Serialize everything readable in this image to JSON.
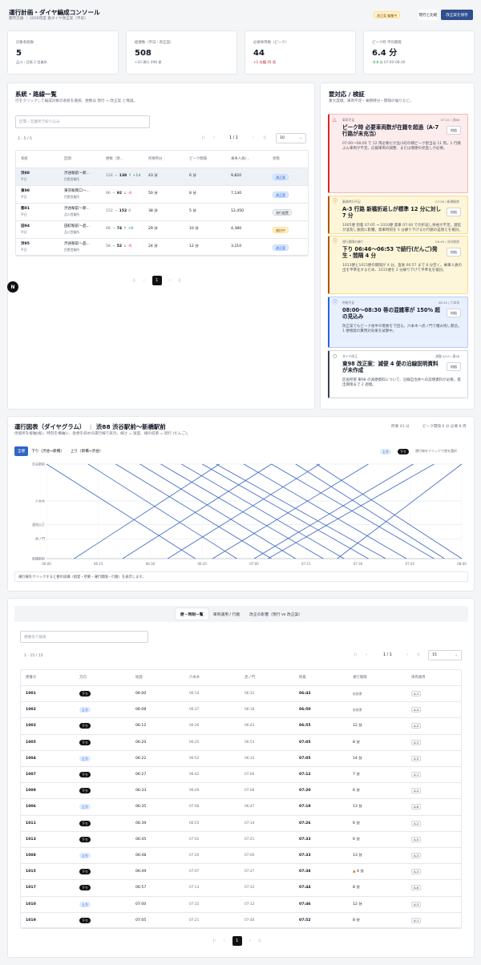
{
  "header": {
    "title": "運行計画・ダイヤ編成コンソール",
    "subtitle": "都市交通 ｜ 2026年度 春ダイヤ改正案（平日）",
    "status_badge": "改正案 編集中",
    "compare_label": "現行と比較",
    "save_label": "改正案を保存"
  },
  "kpis": [
    {
      "label": "対象系統数",
      "value": "5",
      "note": "品川・目黒 2 営業所"
    },
    {
      "label": "総便数（平日・改正案）",
      "value": "508",
      "note": "+10 現行 498 便"
    },
    {
      "label": "必要車両数（ピーク）",
      "value": "44",
      "note": "+1 在籍 45 両"
    },
    {
      "label": "ピーク時 平均間隔",
      "value": "6.4 分",
      "note_delta": "-0.8 分",
      "note": "07:00–08:30"
    }
  ],
  "routes": {
    "title": "系統・路線一覧",
    "description": "行をクリックして編成対象の系統を選択。便数は 現行 → 改正案 と増減。",
    "filter_placeholder": "区間・営業所で絞り込み",
    "count": "1 - 5 / 5",
    "page": "1 / 1",
    "page_size": "10",
    "columns": [
      "系統",
      "区間",
      "便数（現...",
      "所要時分",
      "ピーク間隔",
      "乗車人員/...",
      "状態"
    ],
    "rows": [
      {
        "code": "渋88",
        "day": "平日",
        "section": "渋谷駅前〜新...",
        "depot": "目黒営業所",
        "cur": "124",
        "new": "138",
        "delta": "↑ +14",
        "time": "43 分",
        "interval": "6 分",
        "riders": "9,820",
        "status": "改正案",
        "status_kind": "blue"
      },
      {
        "code": "東98",
        "day": "平日",
        "section": "東京駅南口〜...",
        "depot": "目黒営業所",
        "cur": "96",
        "new": "92",
        "delta": "↓ -4",
        "time": "50 分",
        "interval": "8 分",
        "riders": "7,140",
        "status": "改正案",
        "status_kind": "blue"
      },
      {
        "code": "都01",
        "day": "平日",
        "section": "渋谷駅前〜新...",
        "depot": "品川営業所",
        "cur": "152",
        "new": "152",
        "delta": "0",
        "time": "38 分",
        "interval": "5 分",
        "riders": "12,450",
        "status": "現行据置",
        "status_kind": "gray"
      },
      {
        "code": "田94",
        "day": "平日",
        "section": "田町駅前〜品...",
        "depot": "品川営業所",
        "cur": "68",
        "new": "74",
        "delta": "↑ +6",
        "time": "29 分",
        "interval": "10 分",
        "riders": "4,380",
        "status": "検討中",
        "status_kind": "yellow"
      },
      {
        "code": "渋95",
        "day": "平日",
        "section": "渋谷駅前〜品...",
        "depot": "目黒営業所",
        "cur": "58",
        "new": "52",
        "delta": "↓ -6",
        "time": "24 分",
        "interval": "12 分",
        "riders": "3,210",
        "status": "改正案",
        "status_kind": "blue"
      }
    ],
    "pager_page": "1"
  },
  "alerts": {
    "title": "要対応 / 検証",
    "description": "重大度順。車両不足・乗務時分・間隔の偏りなど。",
    "action_label": "対応",
    "items": [
      {
        "kind": "red",
        "category": "車両不足",
        "meta": "07:12 / 渋88",
        "title": "ピーク時 必要車両数が在籍を超過（A-7 行路が未充当）",
        "body": "07:00〜08:00 で 12 両必要だが品川町の朝ピーク割当は 11 両。1 行路ぶん車両が不足。応援車両の調整、または増便の見直しが必要。"
      },
      {
        "kind": "yellow",
        "category": "乗務時分不足",
        "meta": "07:06 / 新橋駅前",
        "title": "A-3 行路 新橋折返しが標準 12 分に対し 7 分",
        "body": "1005便 到着 07:05 → 1010便 発車 07:00 での折返し余裕が不足。遅延が波及し後続に影響。発車時刻を 5 分繰り下げるか行路の差替えを検討。"
      },
      {
        "kind": "yellow",
        "category": "運行間隔の偏り",
        "meta": "06:49 / 渋谷駅前",
        "title": "下り 06:46〜06:53 で続行(だんご)発生・間隔 4 分",
        "body": "1013便と1015便の間隔が 4 分。直後 06:57 まで 8 分空く。乗車人員の出を平準化するため、1015便を 2 分繰り下げて平準化を検討。"
      },
      {
        "kind": "blue",
        "category": "供給不足",
        "meta": "08:10 / 六本木",
        "title": "08:00〜08:30 帯の混雑率が 150% 超の見込み",
        "body": "改正案でもピーク後半の需要を下回る。六本木〜虎ノ門で積み残し懸念。1 便増発の費用対効果を試算中。"
      },
      {
        "kind": "white",
        "category": "ダイヤ改正",
        "meta": "調整 4/13 / 東98",
        "title": "東98 改正案：減便 4 便の沿線説明資料が未作成",
        "body": "区長所管 東98 の減便資料について、沿線自治体への説明資料が必要。提出期限まで 2 週間。"
      }
    ]
  },
  "diagram": {
    "title": "運行図表（ダイヤグラム）",
    "route": "渋88 渋谷駅前〜新橋駅前",
    "description": "停留所を縦軸(縦)、時刻を横軸に、各便を斜めの運行線で表示。線さ = 速度、線の収束 = 続行 (だんご)。",
    "meta": [
      "所要 43 分",
      "ピーク間隔 6 分",
      "必要 8 両"
    ],
    "tabs": [
      "全便",
      "下り（渋谷→新橋）",
      "上り（新橋→渋谷）"
    ],
    "legend_up": "上り",
    "legend_down": "下り",
    "legend_note": "運行線をクリックで便を選択",
    "stops": [
      "渋谷駅前",
      "六本木",
      "溜池山王",
      "虎ノ門",
      "新橋駅前"
    ],
    "times": [
      "06:00",
      "06:15",
      "06:30",
      "06:45",
      "07:00",
      "07:15",
      "07:30",
      "07:45",
      "08:00"
    ],
    "footer": "運行線をクリックすると便の詳細（始発・所要・運行間隔・行路）を表示します。"
  },
  "trips": {
    "tabs": [
      "便・時刻一覧",
      "車両運用 / 行路",
      "改正の影響（現行 vs 改正案）"
    ],
    "search_placeholder": "便番号で検索",
    "count": "1 - 15 / 15",
    "page": "1 / 1",
    "page_size": "15",
    "columns": [
      "便番号",
      "方向",
      "始発",
      "六本木",
      "虎ノ門",
      "終着",
      "運行間隔",
      "車両運用"
    ],
    "rows": [
      {
        "no": "1001",
        "dir": "下り",
        "start": "06:00",
        "roppongi": "06:14",
        "toranomon": "06:31",
        "end": "06:43",
        "interval": "始発便",
        "vehicle": "A-1"
      },
      {
        "no": "1002",
        "dir": "上り",
        "start": "06:08",
        "roppongi": "06:37",
        "toranomon": "06:18",
        "end": "06:50",
        "interval": "始発便",
        "vehicle": "A-4"
      },
      {
        "no": "1003",
        "dir": "下り",
        "start": "06:12",
        "roppongi": "06:26",
        "toranomon": "06:43",
        "end": "06:55",
        "interval": "12 分",
        "vehicle": "A-2"
      },
      {
        "no": "1005",
        "dir": "下り",
        "start": "06:20",
        "roppongi": "06:35",
        "toranomon": "06:53",
        "end": "07:05",
        "interval": "8 分",
        "vehicle": "A-3"
      },
      {
        "no": "1004",
        "dir": "上り",
        "start": "06:22",
        "roppongi": "06:52",
        "toranomon": "06:33",
        "end": "07:05",
        "interval": "14 分",
        "vehicle": "A-5"
      },
      {
        "no": "1007",
        "dir": "下り",
        "start": "06:27",
        "roppongi": "06:42",
        "toranomon": "07:00",
        "end": "07:12",
        "interval": "7 分",
        "vehicle": "A-1"
      },
      {
        "no": "1009",
        "dir": "下り",
        "start": "06:33",
        "roppongi": "06:49",
        "toranomon": "07:08",
        "end": "07:20",
        "interval": "6 分",
        "vehicle": "A-4"
      },
      {
        "no": "1006",
        "dir": "上り",
        "start": "06:35",
        "roppongi": "07:06",
        "toranomon": "06:47",
        "end": "07:19",
        "interval": "13 分",
        "vehicle": "A-6"
      },
      {
        "no": "1011",
        "dir": "下り",
        "start": "06:39",
        "roppongi": "06:55",
        "toranomon": "07:14",
        "end": "07:26",
        "interval": "6 分",
        "vehicle": "A-2"
      },
      {
        "no": "1013",
        "dir": "下り",
        "start": "06:45",
        "roppongi": "07:02",
        "toranomon": "07:21",
        "end": "07:33",
        "interval": "6 分",
        "vehicle": "A-5"
      },
      {
        "no": "1008",
        "dir": "上り",
        "start": "06:48",
        "roppongi": "07:20",
        "toranomon": "07:00",
        "end": "07:33",
        "interval": "13 分",
        "vehicle": "A-3"
      },
      {
        "no": "1015",
        "dir": "下り",
        "start": "06:49",
        "roppongi": "07:07",
        "toranomon": "07:27",
        "end": "07:38",
        "interval": "4 分",
        "vehicle": "A-3",
        "warn": true
      },
      {
        "no": "1017",
        "dir": "下り",
        "start": "06:57",
        "roppongi": "07:13",
        "toranomon": "07:32",
        "end": "07:44",
        "interval": "8 分",
        "vehicle": "A-6"
      },
      {
        "no": "1010",
        "dir": "上り",
        "start": "07:00",
        "roppongi": "07:32",
        "toranomon": "07:12",
        "end": "07:46",
        "interval": "12 分",
        "vehicle": "A-3"
      },
      {
        "no": "1019",
        "dir": "下り",
        "start": "07:05",
        "roppongi": "07:21",
        "toranomon": "07:40",
        "end": "07:52",
        "interval": "8 分",
        "vehicle": "A-1"
      }
    ],
    "pager_page": "1"
  },
  "colors": {
    "accent": "#2f4f8f",
    "line": "#3b66c4",
    "dark": "#111111",
    "red_bg": "#fdecec",
    "yellow_bg": "#fef6d8",
    "blue_bg": "#e8f0fd"
  }
}
